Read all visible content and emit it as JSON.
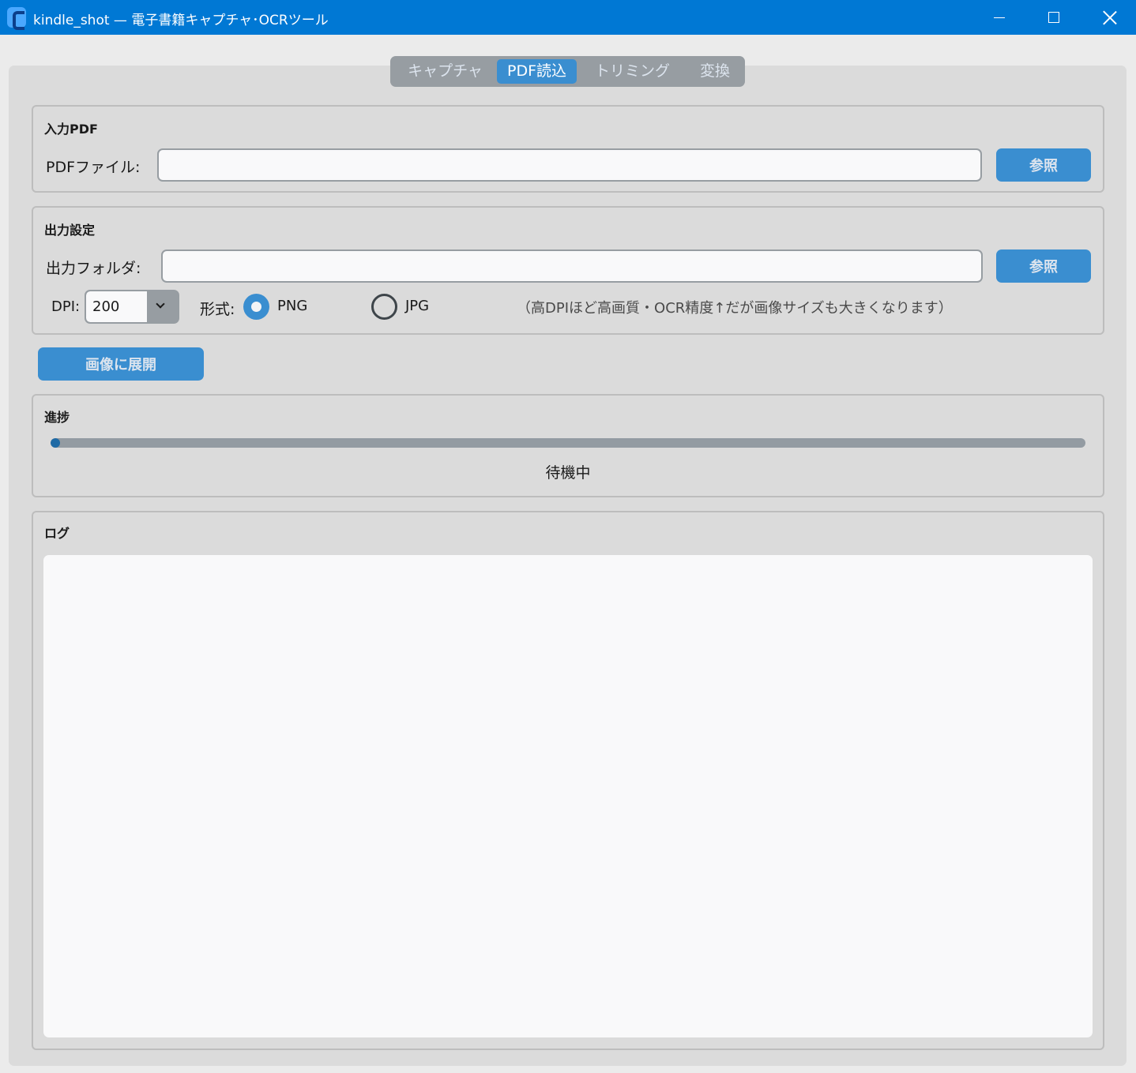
{
  "window": {
    "title": "kindle_shot — 電子書籍キャプチャ･OCRツール",
    "accent_color": "#0078d4"
  },
  "tabs": [
    {
      "label": "キャプチャ",
      "active": false
    },
    {
      "label": "PDF読込",
      "active": true
    },
    {
      "label": "トリミング",
      "active": false
    },
    {
      "label": "変換",
      "active": false
    }
  ],
  "input_section": {
    "title": "入力PDF",
    "pdf_label": "PDFファイル:",
    "pdf_value": "",
    "browse_label": "参照"
  },
  "output_section": {
    "title": "出力設定",
    "folder_label": "出力フォルダ:",
    "folder_value": "",
    "browse_label": "参照",
    "dpi_label": "DPI:",
    "dpi_value": "200",
    "format_label": "形式:",
    "format_options": [
      {
        "label": "PNG",
        "selected": true
      },
      {
        "label": "JPG",
        "selected": false
      }
    ],
    "hint": "（高DPIほど高画質・OCR精度↑だが画像サイズも大きくなります）"
  },
  "extract_button": "画像に展開",
  "progress_section": {
    "title": "進捗",
    "progress": 0,
    "status": "待機中"
  },
  "log_section": {
    "title": "ログ",
    "content": ""
  },
  "colors": {
    "button": "#3a8ed0",
    "panel": "#dbdbdb",
    "progress_track": "#939ba2",
    "progress_fill": "#1f6aa5"
  }
}
